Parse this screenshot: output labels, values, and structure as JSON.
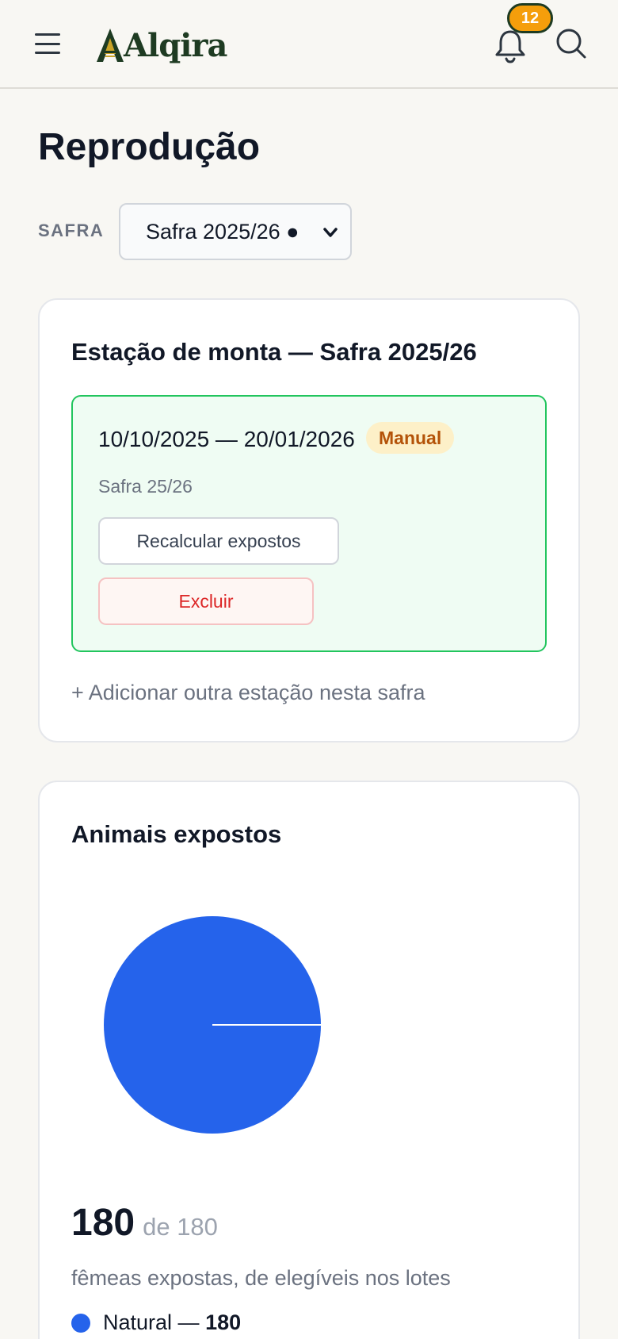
{
  "header": {
    "logo_text": "Alqira",
    "notification_count": "12"
  },
  "page": {
    "title": "Reprodução"
  },
  "safra_filter": {
    "label": "SAFRA",
    "selected": "Safra 2025/26 ●"
  },
  "breeding_station": {
    "title": "Estação de monta — Safra 2025/26",
    "dates": "10/10/2025 — 20/01/2026",
    "mode_badge": "Manual",
    "subtitle": "Safra 25/26",
    "recalc_label": "Recalcular expostos",
    "delete_label": "Excluir",
    "add_label": "+ Adicionar outra estação nesta safra"
  },
  "exposed": {
    "title": "Animais expostos",
    "count": "180",
    "of_total": "de 180",
    "description": "fêmeas expostas, de elegíveis nos lotes",
    "legend_label": "Natural —",
    "legend_value": "180"
  },
  "chart_data": {
    "type": "pie",
    "categories": [
      "Natural"
    ],
    "values": [
      180
    ],
    "colors": [
      "#2563eb"
    ]
  }
}
